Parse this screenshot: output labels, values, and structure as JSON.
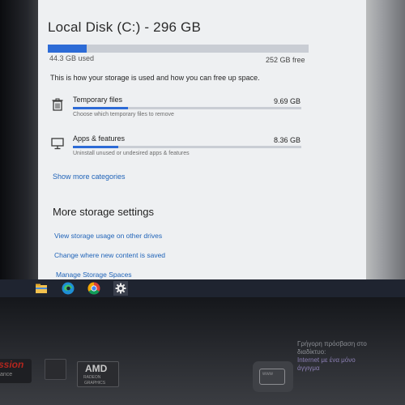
{
  "storage": {
    "title": "Local Disk (C:) - 296 GB",
    "used_label": "44.3 GB used",
    "free_label": "252 GB free",
    "used_fraction": 0.15,
    "description": "This is how your storage is used and how you can free up space.",
    "categories": [
      {
        "name": "Temporary files",
        "size": "9.69 GB",
        "subtitle": "Choose which temporary files to remove",
        "icon": "trash-icon",
        "fill_fraction": 0.24
      },
      {
        "name": "Apps & features",
        "size": "8.36 GB",
        "subtitle": "Uninstall unused or undesired apps & features",
        "icon": "monitor-icon",
        "fill_fraction": 0.2
      }
    ],
    "show_more": "Show more categories"
  },
  "more_settings": {
    "title": "More storage settings",
    "links": [
      "View storage usage on other drives",
      "Change where new content is saved",
      "Manage Storage Spaces"
    ]
  },
  "taskbar": {
    "icons": [
      "file-explorer-icon",
      "edge-icon",
      "chrome-icon",
      "settings-icon"
    ]
  },
  "laptop": {
    "brand_text": "ssion",
    "brand_sub": "ance",
    "amd_text": "AMD",
    "amd_sub1": "RADEON",
    "amd_sub2": "GRAPHICS",
    "popup_icon_text": "www",
    "popup_lines": [
      "Γρήγορη πρόσβαση στο",
      "διαδίκτυο:",
      "Internet με ένα μόνο",
      "άγγιγμα"
    ]
  },
  "colors": {
    "accent": "#2d6bd6",
    "link": "#1f63b8",
    "window_bg": "#eef0f2",
    "taskbar_bg": "#1f2430"
  }
}
